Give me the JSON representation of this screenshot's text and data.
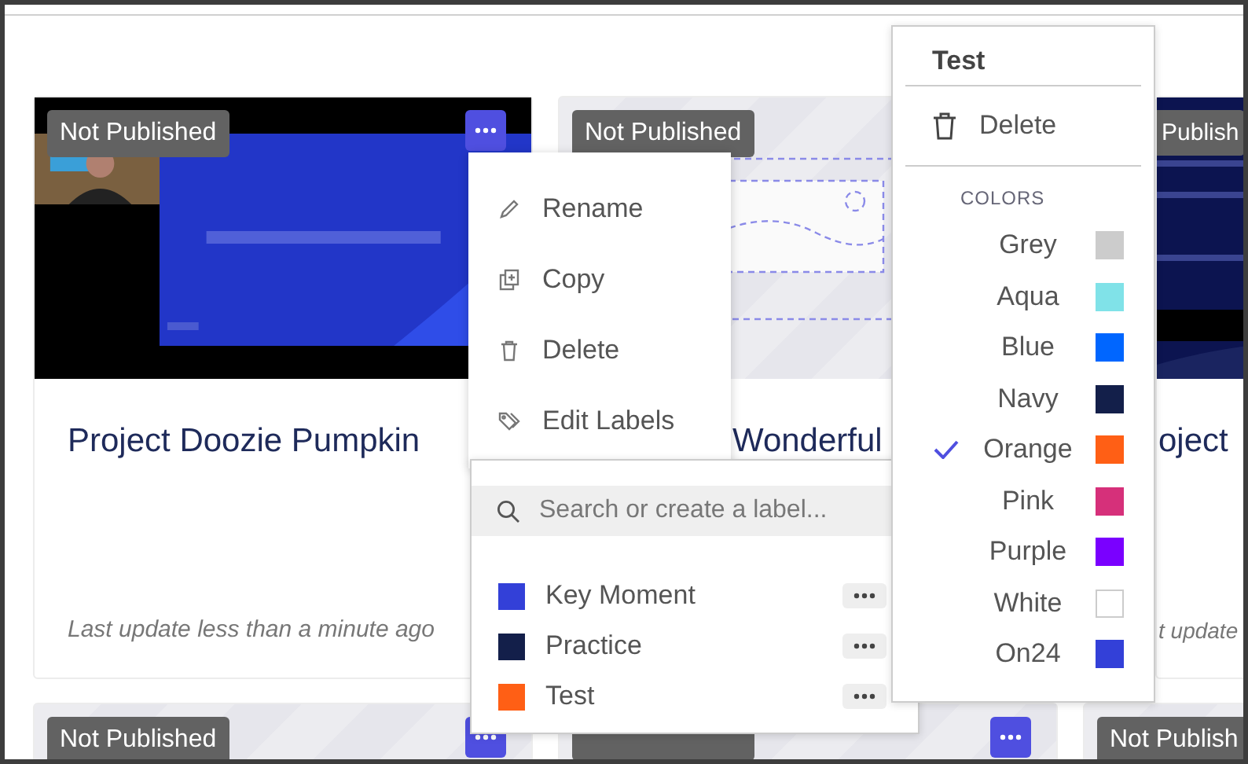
{
  "card_rows": [
    {
      "cards": [
        {
          "status": "Not Published",
          "title": "Project Doozie Pumpkin",
          "updated": "Last update less than a minute ago",
          "menu_button": true
        },
        {
          "status": "Not Published",
          "thumbnail": {
            "kind": "placeholder"
          },
          "title": "Wonderful",
          "menu_button": false
        },
        {
          "status": "Publish",
          "title": "oject",
          "updated": "t update",
          "menu_button": false
        }
      ]
    },
    {
      "cards": [
        {
          "status": "Not Published",
          "thumbnail": {
            "kind": "blank"
          },
          "menu_button": true
        },
        {
          "thumbnail": {
            "kind": "blank"
          },
          "menu_button": true
        },
        {
          "status": "Not Publish",
          "thumbnail": {
            "kind": "blank"
          },
          "menu_button": false
        }
      ]
    }
  ],
  "context_menu": {
    "items": [
      "Rename",
      "Copy",
      "Delete",
      "Edit Labels"
    ]
  },
  "label_panel": {
    "search": {
      "placeholder": "Search or create a label..."
    },
    "labels": [
      {
        "name": "Key Moment",
        "color": "#3340d8"
      },
      {
        "name": "Practice",
        "color": "#131f4a"
      },
      {
        "name": "Test",
        "color": "#ff5f15"
      }
    ]
  },
  "label_editor": {
    "title": "Test",
    "delete": "Delete",
    "colors_heading": "COLORS",
    "colors": [
      {
        "name": "Grey",
        "color": "#cccccc",
        "selected": false
      },
      {
        "name": "Aqua",
        "color": "#80e2e8",
        "selected": false
      },
      {
        "name": "Blue",
        "color": "#0066ff",
        "selected": false
      },
      {
        "name": "Navy",
        "color": "#131f4a",
        "selected": false
      },
      {
        "name": "Orange",
        "color": "#ff5f15",
        "selected": true
      },
      {
        "name": "Pink",
        "color": "#d6307a",
        "selected": false
      },
      {
        "name": "Purple",
        "color": "#7a00ff",
        "selected": false
      },
      {
        "name": "White",
        "color": "#ffffff",
        "selected": false
      },
      {
        "name": "On24",
        "color": "#3340d8",
        "selected": false
      }
    ]
  }
}
